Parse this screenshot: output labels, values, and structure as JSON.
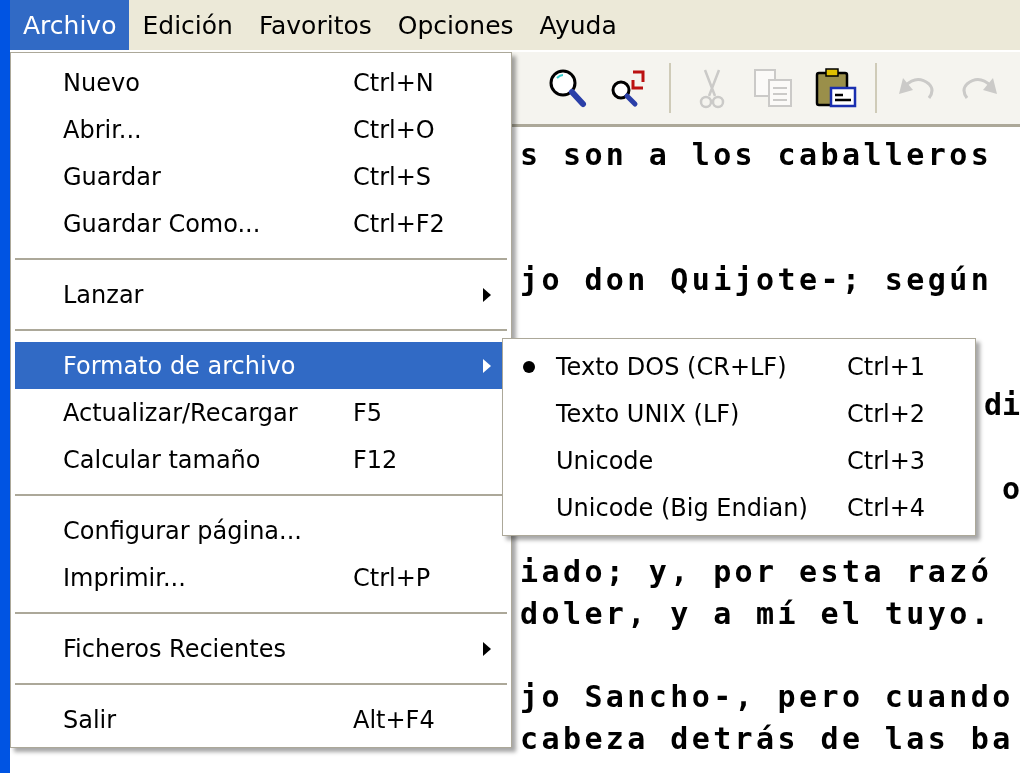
{
  "menu_bar": [
    {
      "label": "Archivo",
      "selected": true
    },
    {
      "label": "Edición",
      "selected": false
    },
    {
      "label": "Favoritos",
      "selected": false
    },
    {
      "label": "Opciones",
      "selected": false
    },
    {
      "label": "Ayuda",
      "selected": false
    }
  ],
  "toolbar": [
    {
      "kind": "search",
      "disabled": false
    },
    {
      "kind": "replace",
      "disabled": false
    },
    {
      "kind": "separator"
    },
    {
      "kind": "cut",
      "disabled": true
    },
    {
      "kind": "copy",
      "disabled": true
    },
    {
      "kind": "paste",
      "disabled": false
    },
    {
      "kind": "separator"
    },
    {
      "kind": "undo",
      "disabled": true
    },
    {
      "kind": "redo",
      "disabled": true
    }
  ],
  "editor_lines": [
    {
      "kind": "text",
      "text": "s son a los caballeros"
    },
    {
      "kind": "blank"
    },
    {
      "kind": "blank"
    },
    {
      "kind": "text",
      "text": "jo don Quijote-; según"
    },
    {
      "kind": "blank"
    },
    {
      "kind": "blank"
    },
    {
      "kind": "tail",
      "text": "di"
    },
    {
      "kind": "blank"
    },
    {
      "kind": "tail",
      "text": "o"
    },
    {
      "kind": "blank"
    },
    {
      "kind": "text",
      "text": "iado; y, por esta razó"
    },
    {
      "kind": "text",
      "text": "doler, y a mí el tuyo."
    },
    {
      "kind": "blank"
    },
    {
      "kind": "text",
      "text": "jo Sancho-, pero cuando"
    },
    {
      "kind": "text",
      "text": "cabeza detrás de las ba"
    }
  ],
  "file_menu": [
    {
      "kind": "item",
      "label": "Nuevo",
      "shortcut": "Ctrl+N",
      "submenu": false,
      "selected": false
    },
    {
      "kind": "item",
      "label": "Abrir...",
      "shortcut": "Ctrl+O",
      "submenu": false,
      "selected": false
    },
    {
      "kind": "item",
      "label": "Guardar",
      "shortcut": "Ctrl+S",
      "submenu": false,
      "selected": false
    },
    {
      "kind": "item",
      "label": "Guardar Como...",
      "shortcut": "Ctrl+F2",
      "submenu": false,
      "selected": false
    },
    {
      "kind": "separator"
    },
    {
      "kind": "item",
      "label": "Lanzar",
      "submenu": true,
      "selected": false
    },
    {
      "kind": "separator"
    },
    {
      "kind": "item",
      "label": "Formato de archivo",
      "submenu": true,
      "selected": true
    },
    {
      "kind": "item",
      "label": "Actualizar/Recargar",
      "shortcut": "F5",
      "submenu": false,
      "selected": false
    },
    {
      "kind": "item",
      "label": "Calcular tamaño",
      "shortcut": "F12",
      "submenu": false,
      "selected": false
    },
    {
      "kind": "separator"
    },
    {
      "kind": "item",
      "label": "Configurar página...",
      "submenu": false,
      "selected": false
    },
    {
      "kind": "item",
      "label": "Imprimir...",
      "shortcut": "Ctrl+P",
      "submenu": false,
      "selected": false
    },
    {
      "kind": "separator"
    },
    {
      "kind": "item",
      "label": "Ficheros Recientes",
      "submenu": true,
      "selected": false
    },
    {
      "kind": "separator"
    },
    {
      "kind": "item",
      "label": "Salir",
      "shortcut": "Alt+F4",
      "submenu": false,
      "selected": false
    }
  ],
  "format_submenu": [
    {
      "label": "Texto DOS (CR+LF)",
      "shortcut": "Ctrl+1",
      "checked": true
    },
    {
      "label": "Texto UNIX (LF)",
      "shortcut": "Ctrl+2",
      "checked": false
    },
    {
      "label": "Unicode",
      "shortcut": "Ctrl+3",
      "checked": false
    },
    {
      "label": "Unicode (Big Endian)",
      "shortcut": "Ctrl+4",
      "checked": false
    }
  ]
}
